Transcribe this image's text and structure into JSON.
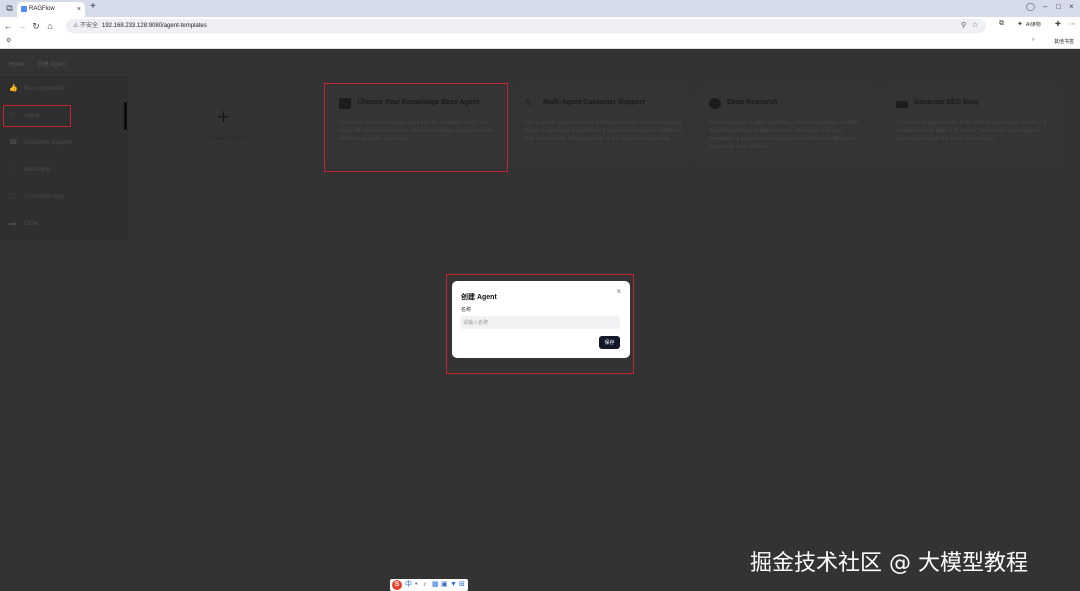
{
  "browser": {
    "tab_title": "RAGFlow",
    "tab_close": "×",
    "new_tab": "+",
    "window_controls": [
      "–",
      "□",
      "×"
    ],
    "insecure_label": "不安全",
    "url": "192.168.233.128:9080/agent-templates",
    "translate_label": "AI读物",
    "bookmarks_label": "其他书签"
  },
  "breadcrumb": [
    "Home",
    "创建 Agent"
  ],
  "sidebar": {
    "items": [
      {
        "label": "Recommended",
        "icon": "thumb-icon"
      },
      {
        "label": "Agent",
        "icon": "agent-icon"
      },
      {
        "label": "Customer Support",
        "icon": "support-icon"
      },
      {
        "label": "Marketing",
        "icon": "marketing-icon"
      },
      {
        "label": "Consumer App",
        "icon": "app-icon"
      },
      {
        "label": "Other",
        "icon": "folder-icon"
      }
    ],
    "active": "Agent"
  },
  "create_card": {
    "label": "Create Agent",
    "icon": "plus-icon"
  },
  "templates": [
    {
      "title": "Choose Your Knowledge Base Agent",
      "description": "Select your desired knowledge base from the dropdown menu. The Agent will only retrieve from the selected knowledge base and use this content to generate responses."
    },
    {
      "title": "Multi-Agent Customer Support",
      "description": "This is a multi-agent system for intelligent customer service processing based on user intent classification. It uses the lead-agent to identify the type of user needs and assign tasks to sub-agents for processing."
    },
    {
      "title": "Deep Research",
      "description": "For professionals in sales, marketing, policy or consulting, the Multi-Agent Deep Research Agent conducts structured, multi-step investigations across diverse sources and delivers consulting-style reports with clear citations."
    },
    {
      "title": "Generate SEO Blog",
      "description": "This is a multi-agent version of the SEO blog generation workflow. It simulates a small team of AI \"writers\", where each agent plays a specialized role just like a real editorial team."
    }
  ],
  "modal": {
    "title": "创建 Agent",
    "close": "×",
    "field_label": "名称",
    "input_placeholder": "请输入名称",
    "input_value": "",
    "save_label": "保存"
  },
  "watermark": "掘金技术社区 @ 大模型教程",
  "colors": {
    "highlight": "#c0262b",
    "primary_button": "#111827",
    "overlay": "#333333"
  }
}
